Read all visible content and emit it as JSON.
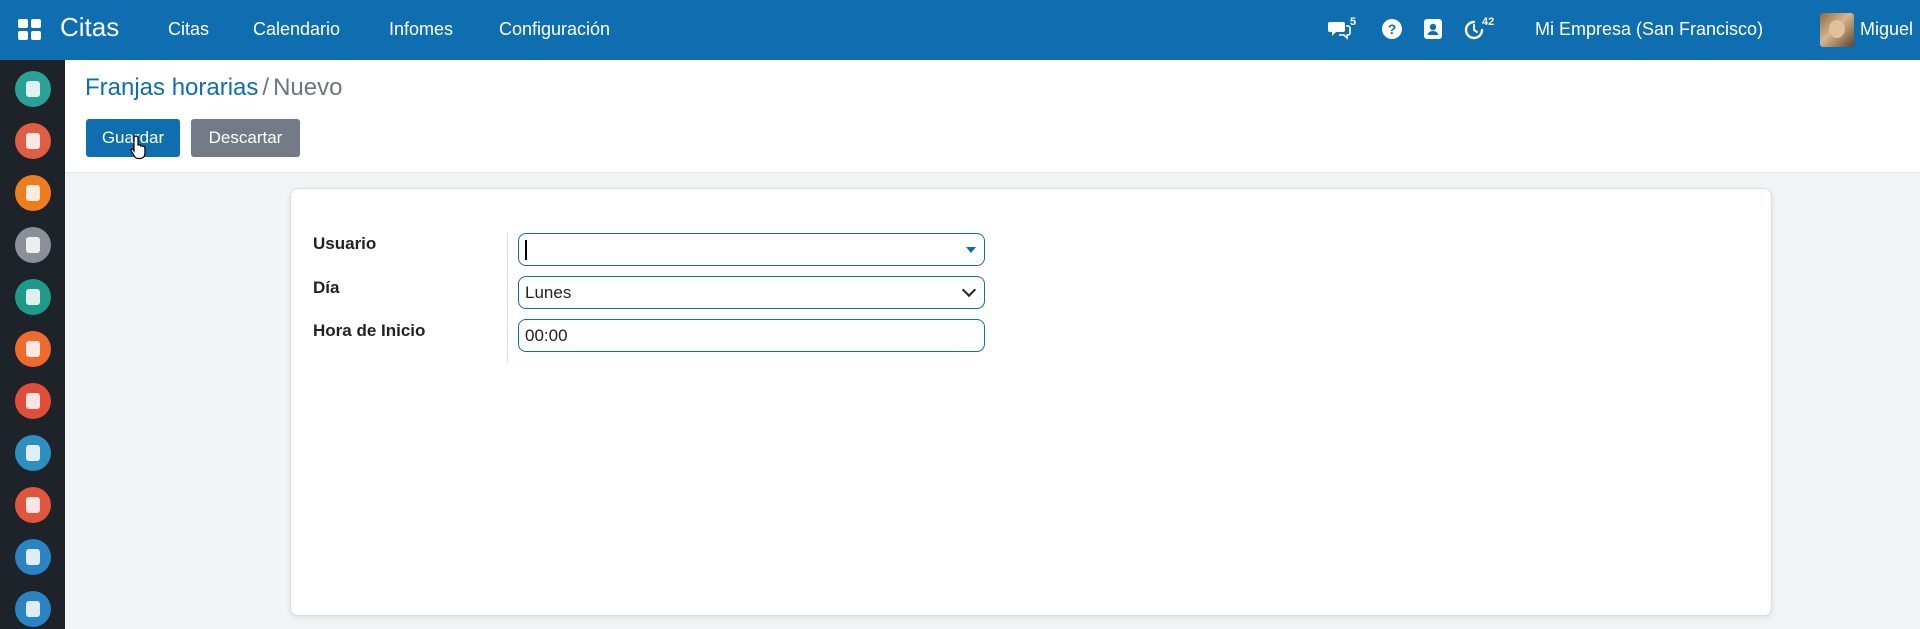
{
  "app": {
    "name": "Citas"
  },
  "menu": {
    "items": [
      {
        "label": "Citas"
      },
      {
        "label": "Calendario"
      },
      {
        "label": "Infomes"
      },
      {
        "label": "Configuración"
      }
    ]
  },
  "systray": {
    "messages_badge": "5",
    "activities_badge": "42",
    "company": "Mi Empresa (San Francisco)",
    "user_name": "Miguel"
  },
  "breadcrumb": {
    "parent": "Franjas horarias",
    "separator": "/",
    "current": "Nuevo"
  },
  "buttons": {
    "save": "Guardar",
    "discard": "Descartar"
  },
  "form": {
    "user": {
      "label": "Usuario",
      "value": ""
    },
    "day": {
      "label": "Día",
      "value": "Lunes"
    },
    "start_time": {
      "label": "Hora de Inicio",
      "value": "00:00"
    }
  },
  "colors": {
    "brand": "#0e6eb0",
    "sidebar": "#1d2329",
    "discard_button": "#757a87"
  },
  "sidebar_apps": [
    {
      "icon": "discuss-icon",
      "color": "#2aa198"
    },
    {
      "icon": "calendar-icon",
      "color": "#e05d44"
    },
    {
      "icon": "notes-icon",
      "color": "#f07d1d"
    },
    {
      "icon": "contacts-icon",
      "color": "#8a8f98"
    },
    {
      "icon": "employees-icon",
      "color": "#1f9a8a"
    },
    {
      "icon": "crm-icon",
      "color": "#ef6a2c"
    },
    {
      "icon": "sales-icon",
      "color": "#e04e39"
    },
    {
      "icon": "dashboard-icon",
      "color": "#2d8fbf"
    },
    {
      "icon": "meeting-icon",
      "color": "#e0553c"
    },
    {
      "icon": "point-of-sale-icon",
      "color": "#2a84c4"
    },
    {
      "icon": "accounting-icon",
      "color": "#2a84c4"
    }
  ]
}
